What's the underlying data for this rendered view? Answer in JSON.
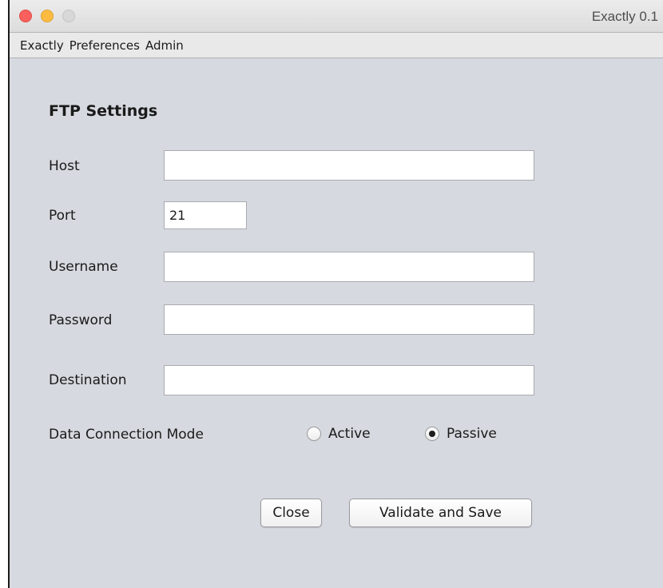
{
  "window": {
    "title": "Exactly 0.1"
  },
  "menubar": {
    "items": [
      "Exactly",
      "Preferences",
      "Admin"
    ]
  },
  "form": {
    "heading": "FTP Settings",
    "host": {
      "label": "Host",
      "value": ""
    },
    "port": {
      "label": "Port",
      "value": "21"
    },
    "username": {
      "label": "Username",
      "value": ""
    },
    "password": {
      "label": "Password",
      "value": ""
    },
    "destination": {
      "label": "Destination",
      "value": ""
    },
    "mode": {
      "label": "Data Connection Mode",
      "options": [
        "Active",
        "Passive"
      ],
      "selected": "Passive"
    }
  },
  "buttons": {
    "close": "Close",
    "save": "Validate and Save"
  },
  "colors": {
    "window_bg": "#d6d9df",
    "close_light": "#fc605c",
    "minimize_light": "#fdbc40",
    "zoom_light": "#d8d8d8"
  }
}
